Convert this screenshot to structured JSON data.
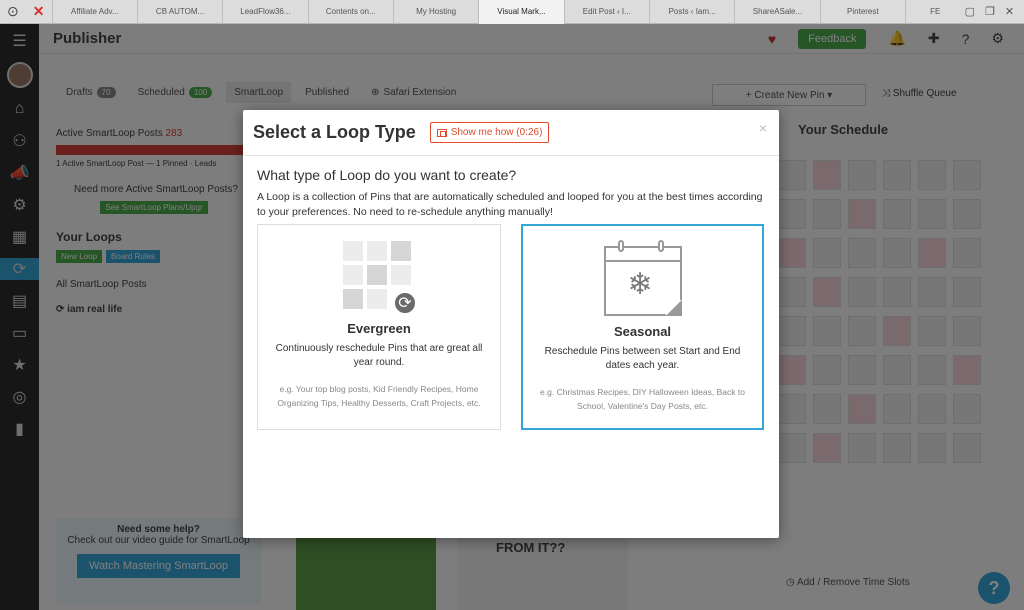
{
  "browser": {
    "tabs": [
      "Affiliate Adv...",
      "CB AUTOM...",
      "LeadFlow36...",
      "Contents on...",
      "My Hosting",
      "Visual Mark...",
      "Edit Post ‹ I...",
      "Posts ‹ Iam...",
      "ShareASale...",
      "Pinterest",
      "FE"
    ],
    "active_tab_index": 5
  },
  "app": {
    "title": "Publisher",
    "feedback_label": "Feedback",
    "tabs": [
      {
        "label": "Drafts",
        "count": "70"
      },
      {
        "label": "Scheduled",
        "count": "100"
      },
      {
        "label": "SmartLoop",
        "count": ""
      },
      {
        "label": "Published",
        "count": ""
      },
      {
        "label": "Safari Extension",
        "count": ""
      }
    ],
    "create_pin_label": "+ Create New Pin ▾",
    "shuffle_label": "Shuffle Queue",
    "left": {
      "active_posts": "Active SmartLoop Posts",
      "active_count": "283",
      "active_sub": "1 Active SmartLoop Post — 1 Pinned · Leads",
      "need_more": "Need more Active SmartLoop Posts?",
      "see_plans": "See SmartLoop Plans/Upgr",
      "your_loops": "Your Loops",
      "new_loop": "New Loop",
      "board_rules": "Board Rules",
      "all_posts": "All SmartLoop Posts",
      "loop_name": "iam real life"
    },
    "schedule_title": "Your Schedule",
    "help_title": "Need some help?",
    "help_sub": "Check out our video guide for SmartLoop",
    "watch_label": "Watch Mastering SmartLoop",
    "add_slots": "Add / Remove Time Slots",
    "bottom_text": "FROM IT??"
  },
  "modal": {
    "title": "Select a Loop Type",
    "show_me_how": "Show me how (0:26)",
    "close": "×",
    "question": "What type of Loop do you want to create?",
    "description": "A Loop is a collection of Pins that are automatically scheduled and looped for you at the best times according to your preferences. No need to re-schedule anything manually!",
    "cards": {
      "evergreen": {
        "title": "Evergreen",
        "subtitle": "Continuously reschedule Pins that are great all year round.",
        "example": "e.g. Your top blog posts, Kid Friendly Recipes, Home Organizing Tips, Healthy Desserts, Craft Projects, etc."
      },
      "seasonal": {
        "title": "Seasonal",
        "subtitle": "Reschedule Pins between set Start and End dates each year.",
        "example": "e.g. Christmas Recipes, DIY Halloween Ideas, Back to School, Valentine's Day Posts, etc."
      }
    }
  },
  "colors": {
    "accent": "#35a7d7",
    "danger": "#e04c2d",
    "success": "#4caa4c"
  }
}
